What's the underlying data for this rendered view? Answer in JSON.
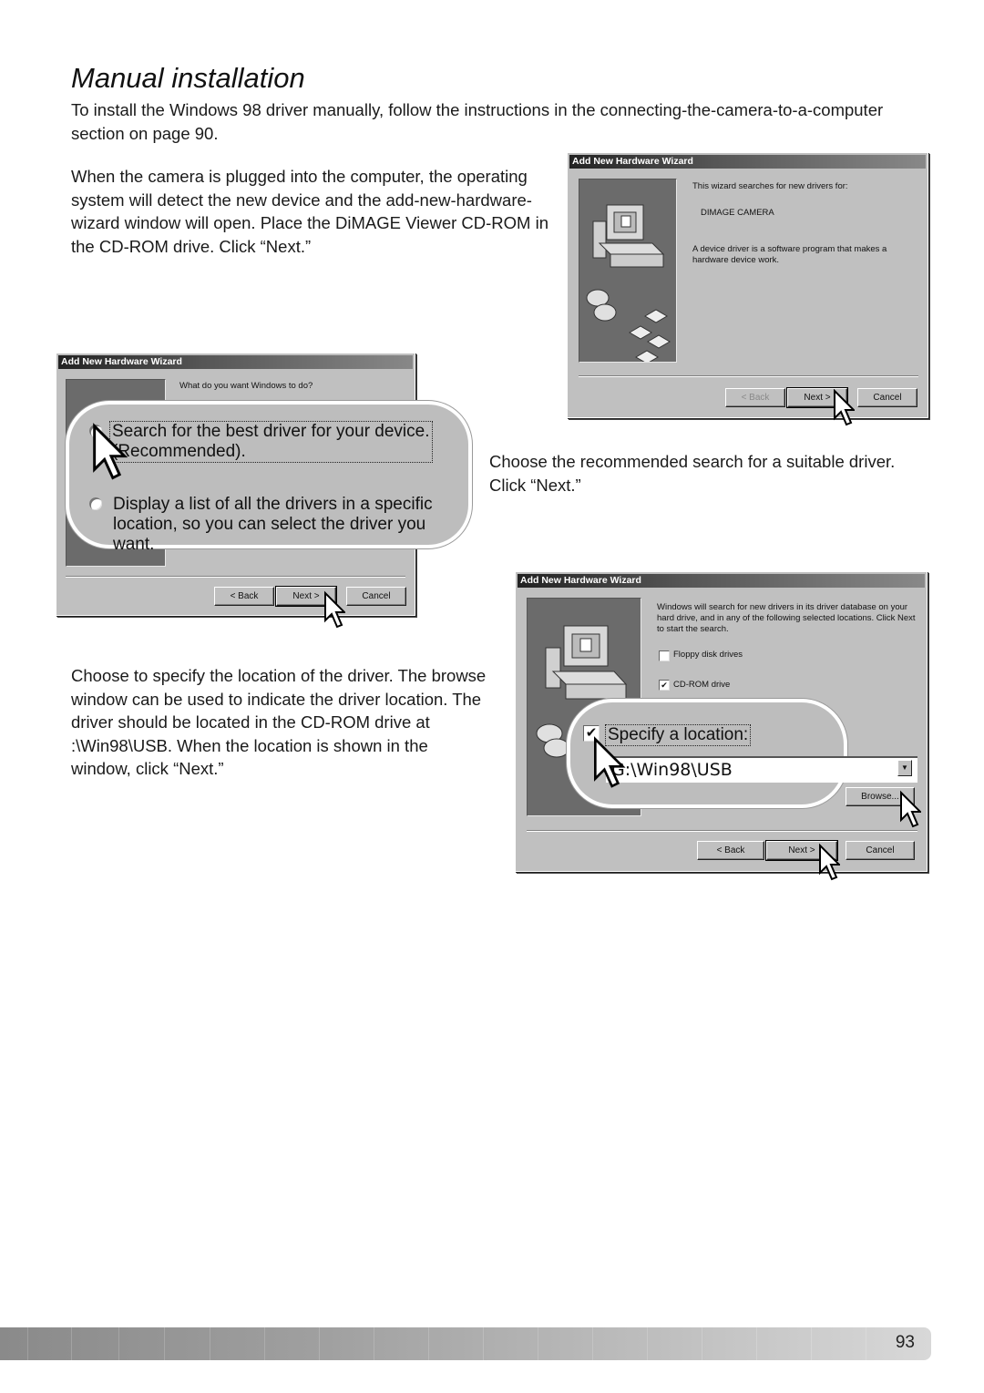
{
  "page": {
    "title": "Manual installation",
    "intro": "To install the Windows 98 driver manually, follow the instructions in the connecting-the-camera-to-a-computer section on page 90.",
    "step1_text": "When the camera is plugged into the computer, the operating system will detect the new device and the add-new-hardware-wizard window will open. Place the DiMAGE Viewer CD-ROM in the CD-ROM drive. Click “Next.”",
    "step2_text": "Choose the recommended search for a suitable driver. Click “Next.”",
    "step3_text": "Choose to specify the location of the driver. The browse window can be used to indicate the driver location. The driver should be located in the CD-ROM drive at :\\Win98\\USB. When the location is shown in the window, click “Next.”",
    "page_number": "93"
  },
  "wizard1": {
    "title": "Add New Hardware Wizard",
    "line1": "This wizard searches for new drivers for:",
    "device": "DIMAGE CAMERA",
    "line2": "A device driver is a software program that makes a hardware device work.",
    "back": "< Back",
    "next": "Next >",
    "cancel": "Cancel"
  },
  "wizard2": {
    "title": "Add New Hardware Wizard",
    "question": "What do you want Windows to do?",
    "option1_line1": "Search for the best driver for your device.",
    "option1_line2": "(Recommended).",
    "option2_line1": "Display a list of all the drivers in a specific",
    "option2_line2": "location, so you can select the driver you want.",
    "selected_option": 1,
    "back": "< Back",
    "next": "Next >",
    "cancel": "Cancel"
  },
  "wizard3": {
    "title": "Add New Hardware Wizard",
    "description": "Windows will search for new drivers in its driver database on your hard drive, and in any of the following selected locations. Click Next to start the search.",
    "floppy_label": "Floppy disk drives",
    "floppy_checked": false,
    "cdrom_label": "CD-ROM drive",
    "cdrom_checked": true,
    "specify_label": "Specify a location:",
    "specify_checked": true,
    "location_value": "G:\\Win98\\USB",
    "browse": "Browse...",
    "back": "< Back",
    "next": "Next >",
    "cancel": "Cancel"
  },
  "icons": {
    "check": "✔",
    "dropdown": "▼"
  }
}
